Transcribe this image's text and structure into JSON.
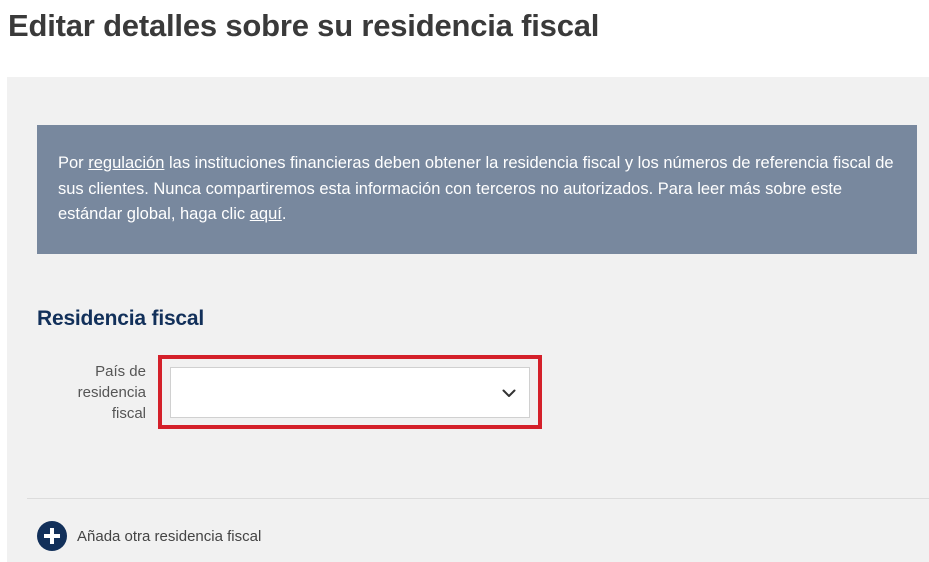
{
  "page": {
    "title": "Editar detalles sobre su residencia fiscal"
  },
  "notice": {
    "text_1": "Por ",
    "link_regulation": "regulación",
    "text_2": " las instituciones financieras deben obtener la residencia fiscal y los números de referencia fiscal de sus clientes. Nunca compartiremos esta información con terceros no autorizados. Para leer más sobre este estándar global, haga clic ",
    "link_here": "aquí",
    "text_3": "."
  },
  "tax_residence": {
    "section_title": "Residencia fiscal",
    "country_label": "País de residencia fiscal",
    "country_value": ""
  },
  "actions": {
    "add_label": "Añada otra residencia fiscal"
  },
  "colors": {
    "notice_bg": "#78889e",
    "panel_bg": "#f1f1f1",
    "brand_navy": "#12305a",
    "highlight_red": "#d4202a"
  },
  "icons": {
    "select_arrow": "chevron-down-icon",
    "add": "plus-circle-icon"
  }
}
